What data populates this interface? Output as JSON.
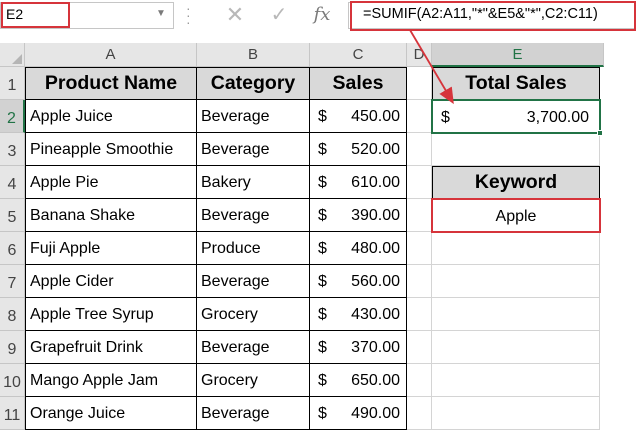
{
  "name_box": {
    "value": "E2"
  },
  "formula_bar": {
    "cancel_icon": "close-icon",
    "enter_icon": "check-icon",
    "fx_label": "fx",
    "formula": "=SUMIF(A2:A11,\"*\"&E5&\"*\",C2:C11)"
  },
  "columns": [
    "A",
    "B",
    "C",
    "D",
    "E"
  ],
  "rows": [
    "1",
    "2",
    "3",
    "4",
    "5",
    "6",
    "7",
    "8",
    "9",
    "10",
    "11"
  ],
  "table": {
    "headers": [
      "Product Name",
      "Category",
      "Sales"
    ],
    "currency": "$",
    "rows": [
      {
        "product": "Apple Juice",
        "category": "Beverage",
        "sales": "450.00"
      },
      {
        "product": "Pineapple Smoothie",
        "category": "Beverage",
        "sales": "520.00"
      },
      {
        "product": "Apple Pie",
        "category": "Bakery",
        "sales": "610.00"
      },
      {
        "product": "Banana Shake",
        "category": "Beverage",
        "sales": "390.00"
      },
      {
        "product": "Fuji Apple",
        "category": "Produce",
        "sales": "480.00"
      },
      {
        "product": "Apple Cider",
        "category": "Beverage",
        "sales": "560.00"
      },
      {
        "product": "Apple Tree Syrup",
        "category": "Grocery",
        "sales": "430.00"
      },
      {
        "product": "Grapefruit Drink",
        "category": "Beverage",
        "sales": "370.00"
      },
      {
        "product": "Mango Apple Jam",
        "category": "Grocery",
        "sales": "650.00"
      },
      {
        "product": "Orange Juice",
        "category": "Beverage",
        "sales": "490.00"
      }
    ]
  },
  "total_sales": {
    "label": "Total Sales",
    "currency": "$",
    "value": "3,700.00"
  },
  "keyword": {
    "label": "Keyword",
    "value": "Apple"
  },
  "colors": {
    "accent": "#217346",
    "highlight": "#d6343b",
    "header_fill": "#d9d9d9"
  }
}
